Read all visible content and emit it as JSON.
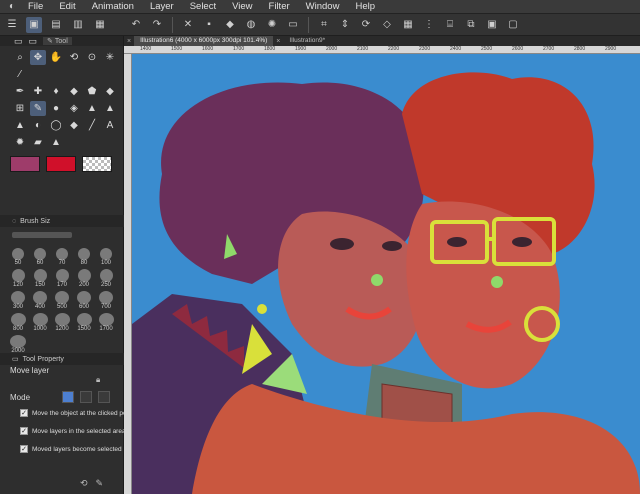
{
  "menu": {
    "items": [
      "File",
      "Edit",
      "Animation",
      "Layer",
      "Select",
      "View",
      "Filter",
      "Window",
      "Help"
    ]
  },
  "tool_panel": {
    "tab_label": "Tool"
  },
  "brush_size": {
    "title": "Brush Siz",
    "sizes": [
      "50",
      "60",
      "70",
      "80",
      "100",
      "120",
      "150",
      "170",
      "200",
      "250",
      "300",
      "400",
      "500",
      "600",
      "700",
      "800",
      "1000",
      "1200",
      "1500",
      "1700",
      "2000"
    ]
  },
  "tool_property": {
    "title": "Tool Property",
    "current_tool": "Move layer",
    "mode_label": "Mode",
    "options": [
      "Move the object at the clicked po",
      "Move layers in the selected area",
      "Moved layers become selected"
    ]
  },
  "documents": {
    "tabs": [
      "Illustration6 (4000 x 6000px 300dpi 101.4%)",
      "Illustration9*"
    ]
  },
  "ruler": {
    "marks": [
      "1400",
      "1500",
      "1600",
      "1700",
      "1800",
      "1900",
      "2000",
      "2100",
      "2200",
      "2300",
      "2400",
      "2500",
      "2600",
      "2700",
      "2800",
      "2900"
    ]
  },
  "colors": {
    "main": "#9e3c6a",
    "sub": "#d0102a",
    "accent": "#4d5f7a",
    "canvas_bg": "#3a8ccf"
  }
}
